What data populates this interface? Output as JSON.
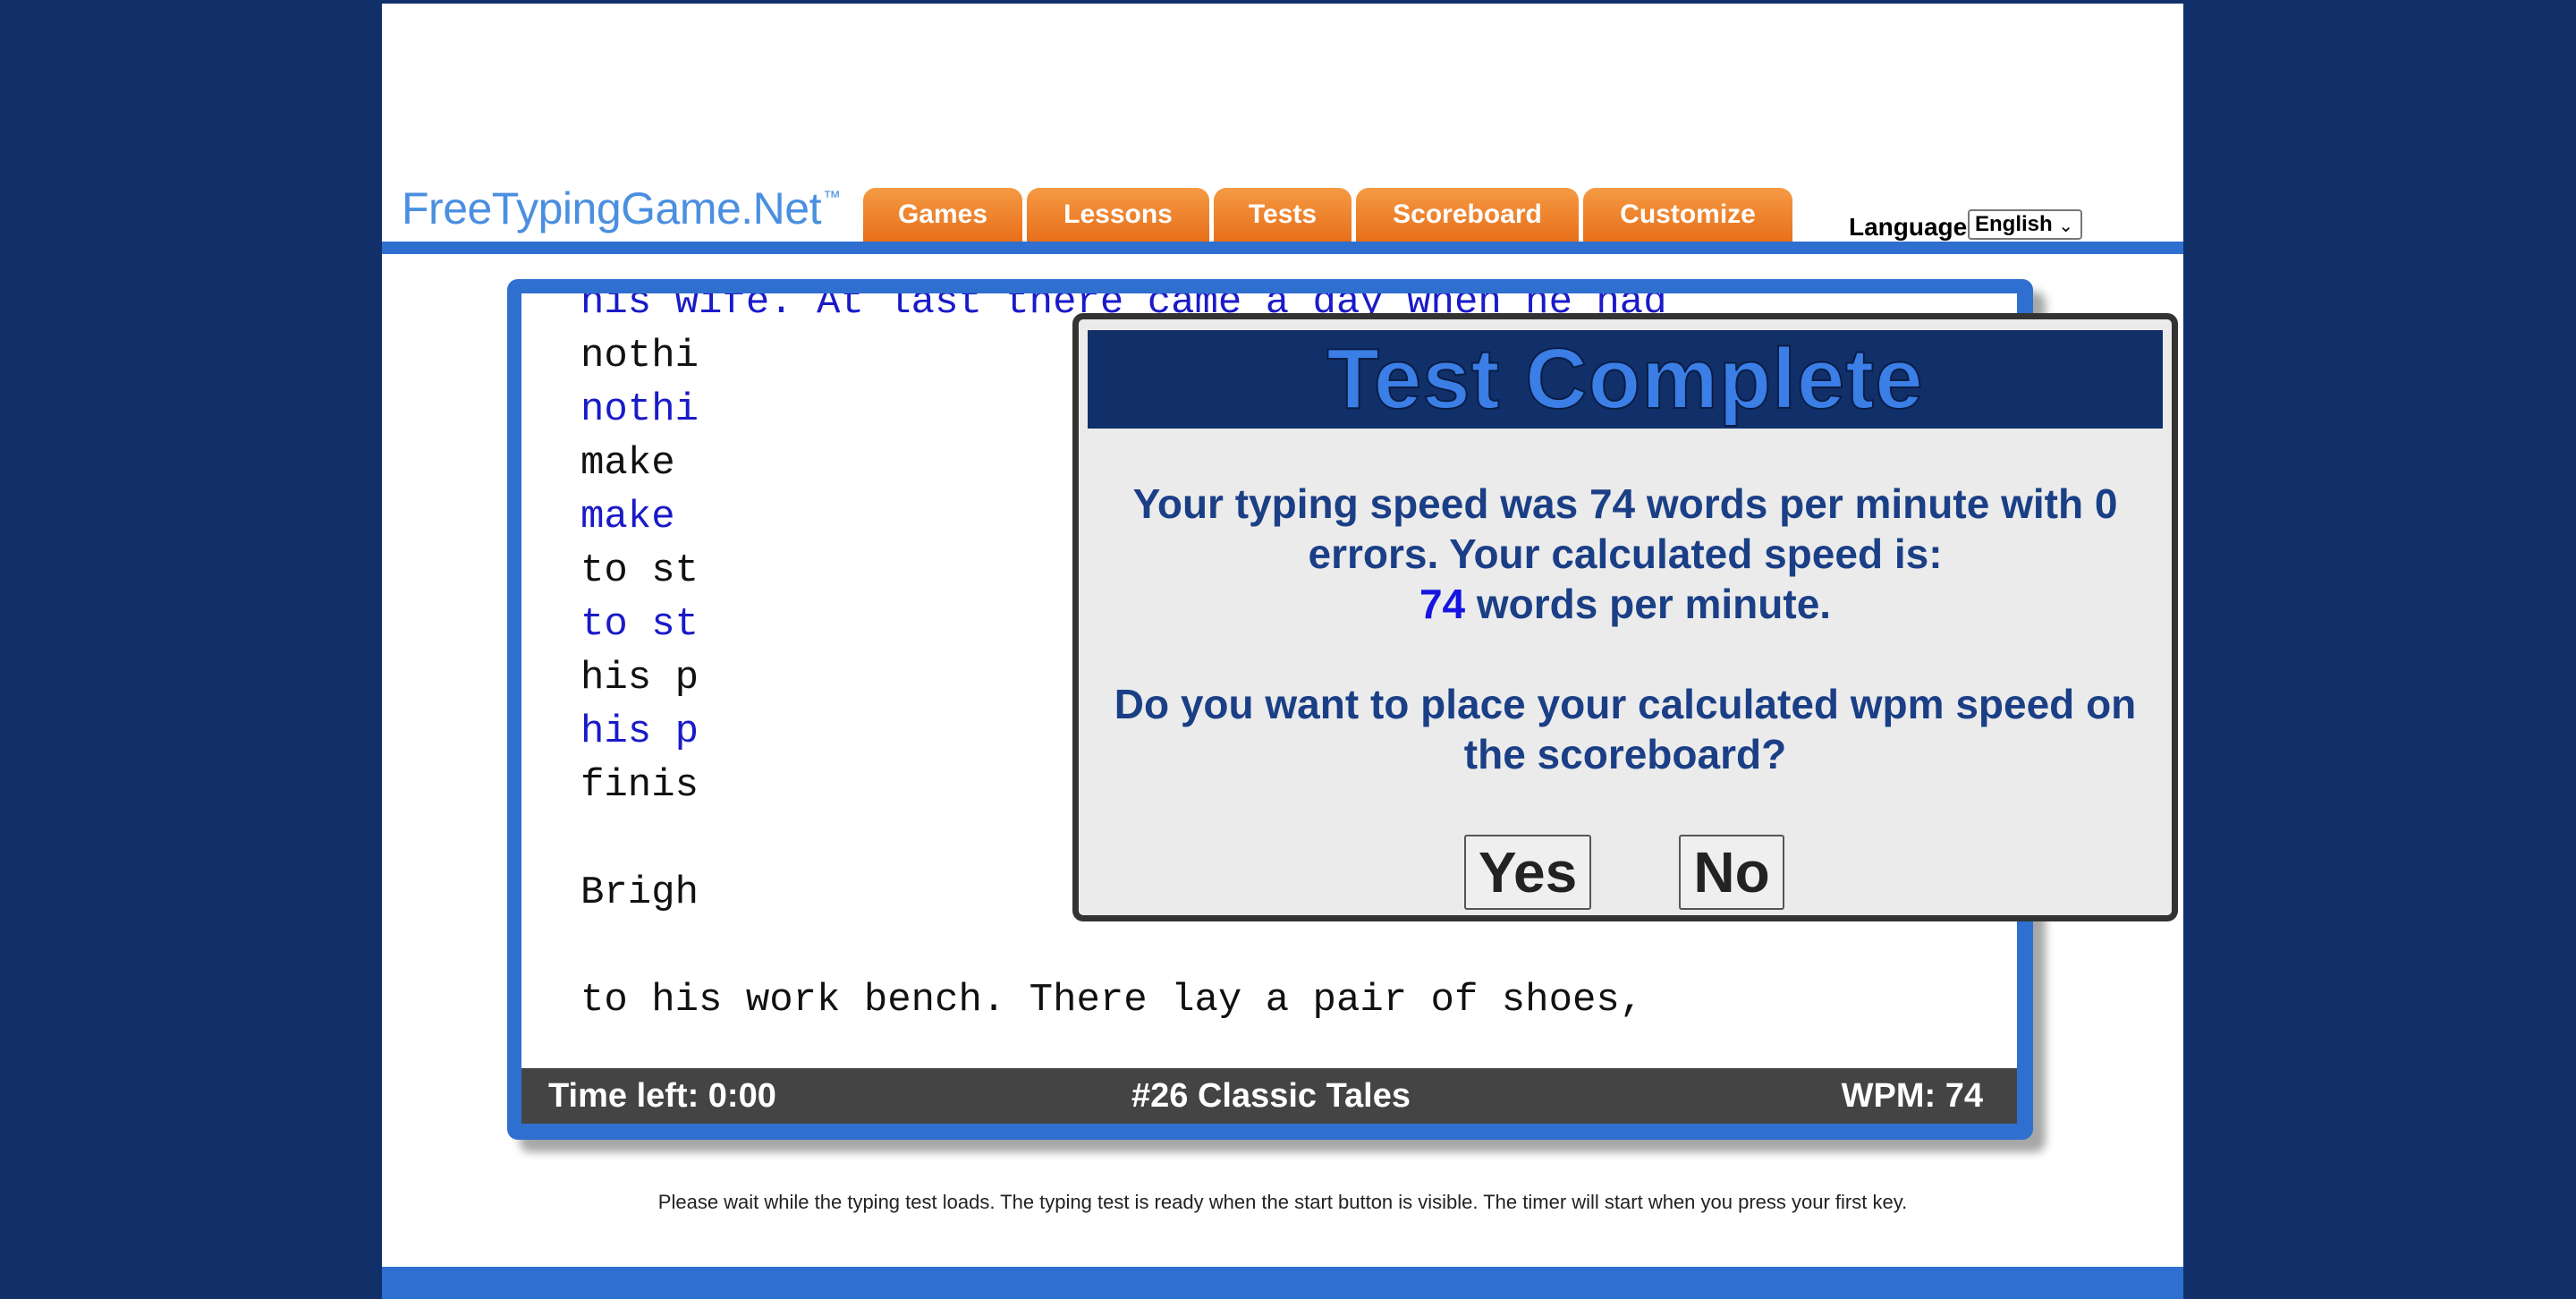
{
  "site": {
    "logo": "FreeTypingGame.Net",
    "logo_mark": "™"
  },
  "nav": {
    "tabs": [
      {
        "label": "Games"
      },
      {
        "label": "Lessons"
      },
      {
        "label": "Tests"
      },
      {
        "label": "Scoreboard"
      },
      {
        "label": "Customize"
      }
    ]
  },
  "language": {
    "label": "Language",
    "selected": "English"
  },
  "test_text": {
    "lines": [
      {
        "text": "his wife. At last there came a day when he had",
        "kind": "typed"
      },
      {
        "text": "nothi                                      gh to",
        "kind": "target"
      },
      {
        "text": "nothi                                      gh to",
        "kind": "typed"
      },
      {
        "text": "make                                      eady",
        "kind": "target"
      },
      {
        "text": "make                                      eady",
        "kind": "typed"
      },
      {
        "text": "to st                                      said",
        "kind": "target"
      },
      {
        "text": "to st                                      said",
        "kind": "typed"
      },
      {
        "text": "his p                                      ould",
        "kind": "target"
      },
      {
        "text": "his p",
        "kind": "typed"
      },
      {
        "text": "finis",
        "kind": "target"
      },
      {
        "text": "",
        "kind": "target"
      },
      {
        "text": "Brigh                                      went",
        "kind": "target"
      },
      {
        "text": "",
        "kind": "target"
      },
      {
        "text": "to his work bench. There lay a pair of shoes,",
        "kind": "target"
      }
    ]
  },
  "status": {
    "time_left": "Time left: 0:00",
    "test_name": "#26 Classic Tales",
    "wpm": "WPM: 74"
  },
  "modal": {
    "title": "Test Complete",
    "line1": "Your typing speed was 74 words per minute with 0",
    "line2": "errors. Your calculated speed is:",
    "calc_wpm": "74",
    "calc_suffix": " words per minute.",
    "question1": "Do you want to place your calculated wpm speed on",
    "question2": "the scoreboard?",
    "yes_label": "Yes",
    "no_label": "No"
  },
  "footnote": "Please wait while the typing test loads. The typing test is ready when the start button is visible. The timer will start when you press your first key.",
  "colors": {
    "background": "#11306a",
    "accent_blue": "#2f6fd0",
    "tab_orange": "#f08a33",
    "typed_text": "#1a1ac8"
  }
}
